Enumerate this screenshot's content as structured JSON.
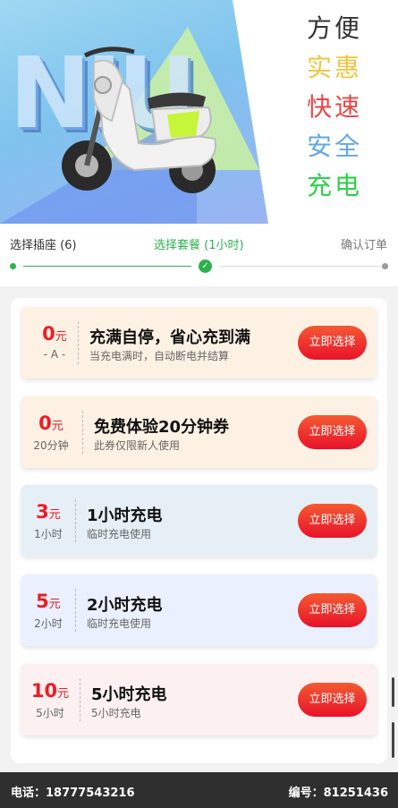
{
  "banner": {
    "slogan": [
      "方便",
      "实惠",
      "快速",
      "安全",
      "充电"
    ],
    "slogan_colors": [
      "#333333",
      "#f3c43b",
      "#e94545",
      "#62a7e2",
      "#2fcf4c"
    ]
  },
  "steps": {
    "step1": "选择插座 (6)",
    "step2": "选择套餐 (1小时)",
    "step3": "确认订单",
    "colors": {
      "active": "#2bb24c",
      "inactive": "#999999"
    }
  },
  "plans": [
    {
      "price": "0",
      "unit": "元",
      "sub": "- A -",
      "title": "充满自停，省心充到满",
      "desc": "当充电满时，自动断电并结算",
      "button": "立即选择",
      "bg": "#fdf1e4"
    },
    {
      "price": "0",
      "unit": "元",
      "sub": "20分钟",
      "title": "免费体验20分钟券",
      "desc": "此券仅限新人使用",
      "button": "立即选择",
      "bg": "#fdf1e4"
    },
    {
      "price": "3",
      "unit": "元",
      "sub": "1小时",
      "title": "1小时充电",
      "desc": "临时充电使用",
      "button": "立即选择",
      "bg": "#e5eff5"
    },
    {
      "price": "5",
      "unit": "元",
      "sub": "2小时",
      "title": "2小时充电",
      "desc": "临时充电使用",
      "button": "立即选择",
      "bg": "#eaf0fd"
    },
    {
      "price": "10",
      "unit": "元",
      "sub": "5小时",
      "title": "5小时充电",
      "desc": "5小时充电",
      "button": "立即选择",
      "bg": "#fdf0f0"
    }
  ],
  "footer": {
    "phone": "电话：18777543216",
    "code": "编号：81251436"
  }
}
